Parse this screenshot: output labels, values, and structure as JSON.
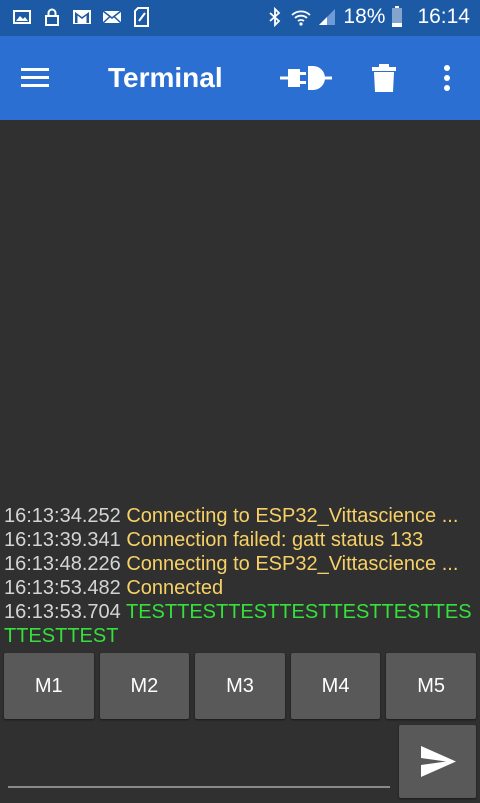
{
  "status_bar": {
    "icons_left": [
      "image-icon",
      "lock-icon",
      "gmail-icon",
      "mail-icon",
      "sim-icon"
    ],
    "icons_right": [
      "bluetooth-icon",
      "wifi-icon",
      "signal-icon",
      "battery-icon"
    ],
    "battery": "18%",
    "time": "16:14"
  },
  "app_bar": {
    "title": "Terminal",
    "icons": [
      "menu-icon",
      "plug-icon",
      "trash-icon",
      "more-vert-icon"
    ]
  },
  "terminal": {
    "lines": [
      {
        "time": "16:13:34.252",
        "text": "Connecting to ESP32_Vittascience ...",
        "kind": "status"
      },
      {
        "time": "16:13:39.341",
        "text": "Connection failed: gatt status 133",
        "kind": "status"
      },
      {
        "time": "16:13:48.226",
        "text": "Connecting to ESP32_Vittascience ...",
        "kind": "status"
      },
      {
        "time": "16:13:53.482",
        "text": "Connected",
        "kind": "status"
      },
      {
        "time": "16:13:53.704",
        "text": "TESTTESTTESTTESTTESTTESTTESTTESTTEST",
        "kind": "received"
      }
    ]
  },
  "macros": [
    "M1",
    "M2",
    "M3",
    "M4",
    "M5"
  ],
  "input": {
    "value": "",
    "placeholder": ""
  },
  "colors": {
    "status_bar": "#1c5aa6",
    "app_bar": "#2b6fd2",
    "background": "#303030",
    "status_text": "#f7d166",
    "received_text": "#35e03a"
  }
}
